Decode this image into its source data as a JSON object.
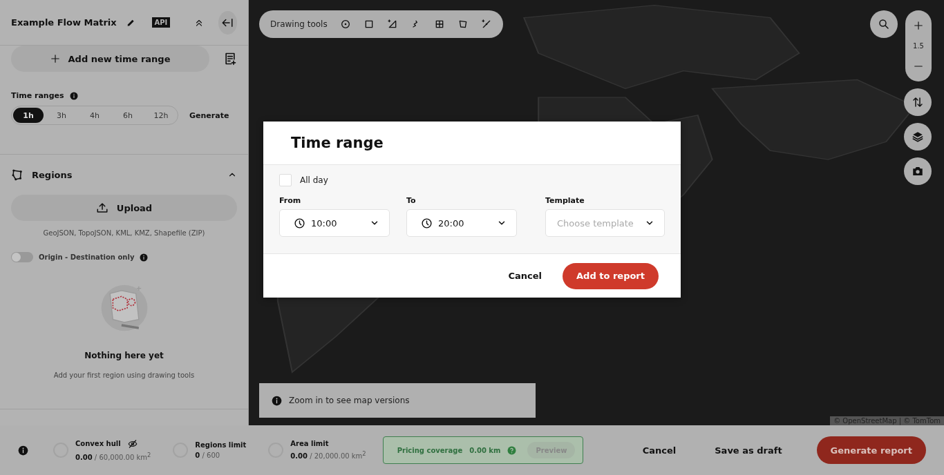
{
  "sidebar": {
    "title": "Example Flow Matrix",
    "api_badge": "API",
    "add_button": "Add new time range",
    "time_ranges": {
      "label": "Time ranges",
      "options": [
        {
          "label": "1h",
          "selected": true
        },
        {
          "label": "3h",
          "selected": false
        },
        {
          "label": "4h",
          "selected": false
        },
        {
          "label": "6h",
          "selected": false
        },
        {
          "label": "12h",
          "selected": false
        }
      ],
      "generate": "Generate"
    },
    "regions": {
      "title": "Regions",
      "expanded": true,
      "upload": "Upload",
      "formats": "GeoJSON, TopoJSON, KML, KMZ, Shapefile (ZIP)",
      "toggle": {
        "label": "Origin - Destination only",
        "on": false
      },
      "empty_title": "Nothing here yet",
      "empty_text": "Add your first region using drawing tools"
    }
  },
  "drawing_tools": {
    "label": "Drawing tools"
  },
  "map": {
    "zoom_level": "1.5",
    "notice": "Zoom in to see map versions",
    "attribution": "© OpenStreetMap | © TomTom"
  },
  "modal": {
    "title": "Time range",
    "all_day": {
      "label": "All day",
      "checked": false
    },
    "fields": [
      {
        "kind": "time",
        "label": "From",
        "value": "10:00"
      },
      {
        "kind": "time",
        "label": "To",
        "value": "20:00"
      },
      {
        "kind": "select",
        "label": "Template",
        "placeholder": "Choose template"
      }
    ],
    "cancel": "Cancel",
    "confirm": "Add to report"
  },
  "bottom_bar": {
    "metrics": [
      {
        "title": "Convex hull",
        "value": "0.00",
        "limit": "/ 60,000.00 km$^{2}$",
        "hidden": true
      },
      {
        "title": "Regions limit",
        "value": "0",
        "limit": "/ 600",
        "hidden": false
      },
      {
        "title": "Area limit",
        "value": "0.00",
        "limit": "/ 20,000.00 km$^{2}$",
        "hidden": false
      }
    ],
    "pricing": {
      "label": "Pricing coverage",
      "value": "0.00 km",
      "preview": "Preview",
      "preview_disabled": true
    },
    "actions": [
      {
        "kind": "text",
        "label": "Cancel"
      },
      {
        "kind": "text",
        "label": "Save as draft"
      },
      {
        "kind": "primary",
        "label": "Generate report"
      }
    ]
  }
}
